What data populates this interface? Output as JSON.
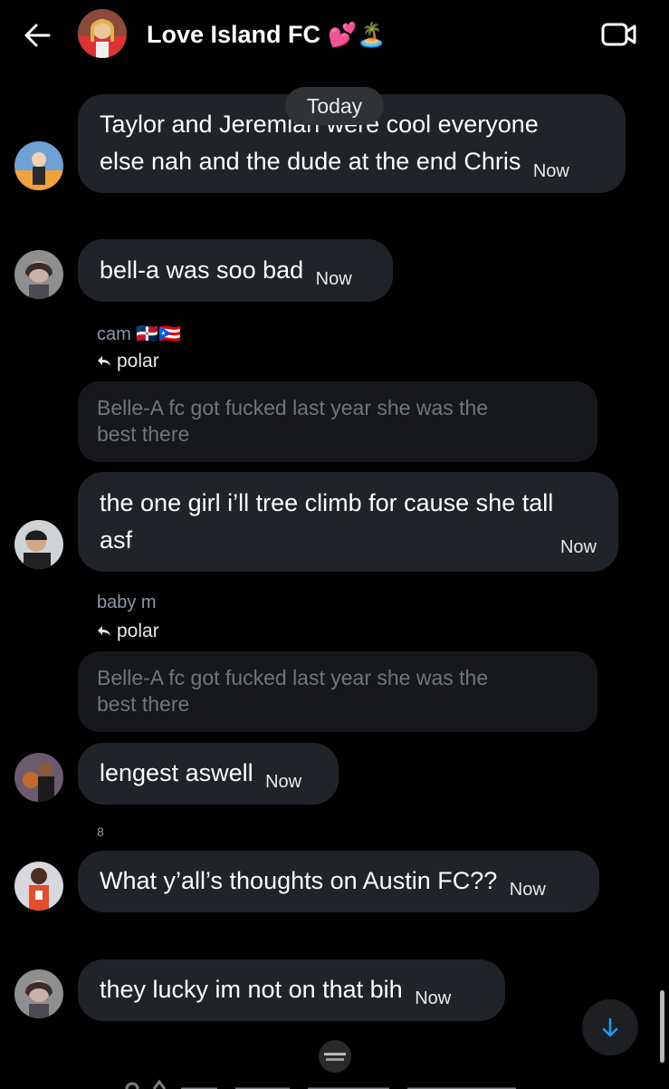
{
  "header": {
    "title": "Love Island FC",
    "emoji": "💕🏝️",
    "back_icon": "arrow-left-icon",
    "video_icon": "video-call-icon"
  },
  "divider": {
    "today": "Today"
  },
  "messages": [
    {
      "text_lines": [
        "Taylor and Jeremiah were cool everyone",
        "else nah and the dude at the end Chris"
      ],
      "time": "Now"
    },
    {
      "text": "bell-a was soo bad",
      "time": "Now"
    },
    {
      "sender": "cam 🇩🇴🇵🇷",
      "reply_to": "polar",
      "quote_lines": [
        "Belle-A fc got fucked last year  she was the",
        "best there"
      ],
      "text_lines": [
        "the one girl i’ll tree climb for cause she tall",
        "asf"
      ],
      "time": "Now"
    },
    {
      "sender": "baby m",
      "reply_to": "polar",
      "quote_lines": [
        "Belle-A fc got fucked last year  she was the",
        "best there"
      ],
      "text": "lengest aswell",
      "time": "Now"
    },
    {
      "sender": "8",
      "text": "What y’all’s thoughts on Austin FC??",
      "time": "Now"
    },
    {
      "text": "they lucky im not on that bih",
      "time": "Now"
    }
  ],
  "colors": {
    "bubble": "#202327",
    "quote": "#16181c",
    "accent": "#1d9bf0"
  }
}
